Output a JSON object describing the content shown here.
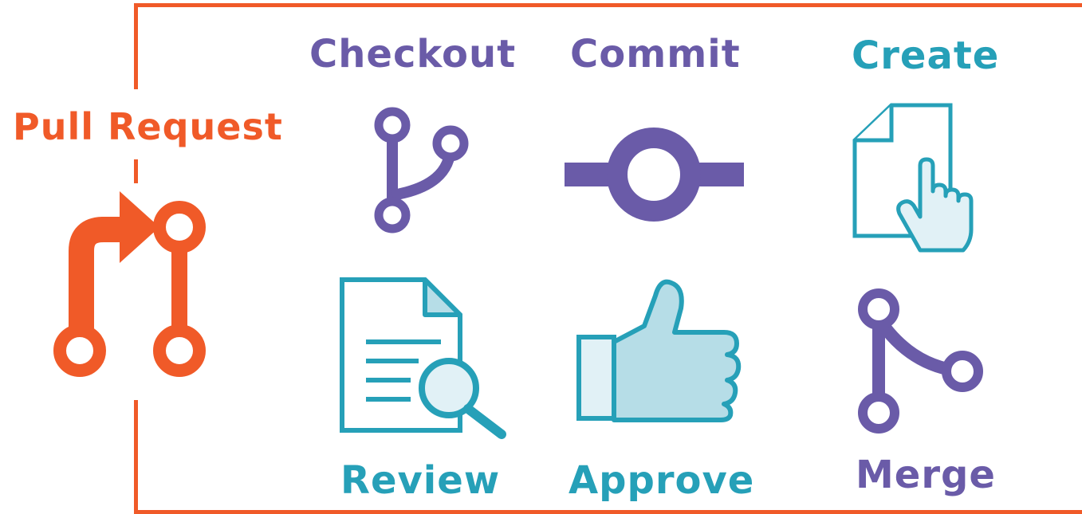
{
  "main_title": "Pull Request",
  "steps": [
    {
      "label": "Checkout",
      "icon": "git-branch-icon",
      "color": "#6a5ba8"
    },
    {
      "label": "Commit",
      "icon": "git-commit-icon",
      "color": "#6a5ba8"
    },
    {
      "label": "Create",
      "icon": "document-pointer-hand-icon",
      "color": "#26a0b8"
    },
    {
      "label": "Review",
      "icon": "document-magnifier-icon",
      "color": "#26a0b8"
    },
    {
      "label": "Approve",
      "icon": "thumbs-up-icon",
      "color": "#26a0b8"
    },
    {
      "label": "Merge",
      "icon": "git-merge-icon",
      "color": "#6a5ba8"
    }
  ],
  "colors": {
    "accent": "#f05a28",
    "purple": "#6a5ba8",
    "teal": "#26a0b8",
    "light_teal": "#b6dde7",
    "pale_teal": "#e1f1f6"
  }
}
